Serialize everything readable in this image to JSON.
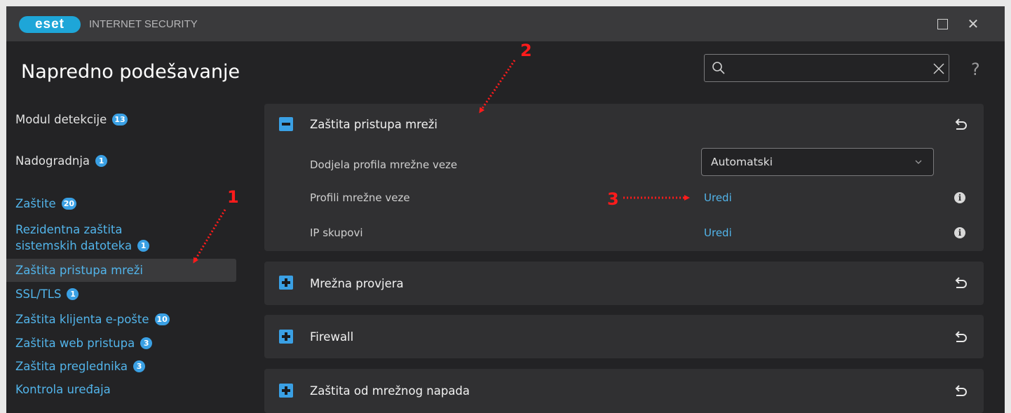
{
  "app": {
    "logo_text": "eset",
    "product_name": "INTERNET SECURITY"
  },
  "header": {
    "title": "Napredno podešavanje",
    "search_placeholder": "",
    "help_label": "?"
  },
  "sidebar": {
    "items": [
      {
        "label": "Modul detekcije",
        "badge": "13"
      },
      {
        "label": "Nadogradnja",
        "badge": "1"
      },
      {
        "label": "Zaštite",
        "badge": "20"
      },
      {
        "label_line1": "Rezidentna zaštita",
        "label_line2": "sistemskih datoteka",
        "badge": "1"
      },
      {
        "label": "Zaštita pristupa mreži",
        "active": true
      },
      {
        "label": "SSL/TLS",
        "badge": "1"
      },
      {
        "label": "Zaštita klijenta e-pošte",
        "badge": "10"
      },
      {
        "label": "Zaštita web pristupa",
        "badge": "3"
      },
      {
        "label": "Zaštita preglednika",
        "badge": "3"
      },
      {
        "label": "Kontrola uređaja"
      }
    ]
  },
  "main": {
    "panels": [
      {
        "title": "Zaštita pristupa mreži",
        "expanded": true,
        "rows": [
          {
            "label": "Dodjela profila mrežne veze",
            "value": "Automatski",
            "control": "select"
          },
          {
            "label": "Profili mrežne veze",
            "value": "Uredi",
            "control": "link",
            "info_icon": "info-icon"
          },
          {
            "label": "IP skupovi",
            "value": "Uredi",
            "control": "link",
            "info_icon": "info-icon"
          }
        ]
      },
      {
        "title": "Mrežna provjera",
        "expanded": false
      },
      {
        "title": "Firewall",
        "expanded": false
      },
      {
        "title": "Zaštita od mrežnog napada",
        "expanded": false
      }
    ]
  },
  "annotations": {
    "marker_1": "1",
    "marker_2": "2",
    "marker_3": "3",
    "color": "#ff1b1b"
  },
  "colors": {
    "accent": "#3aa0e4",
    "link": "#52b4ea",
    "background": "#232325",
    "panel": "#303032"
  }
}
